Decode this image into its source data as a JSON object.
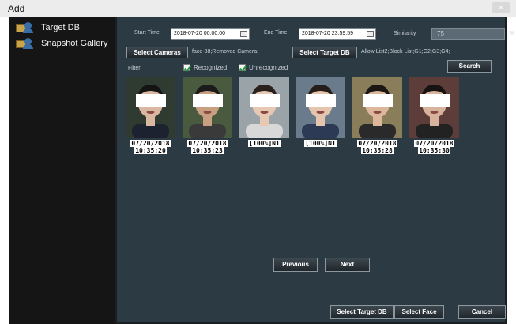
{
  "window": {
    "title": "Add",
    "close_label": "×"
  },
  "sidebar": {
    "items": [
      {
        "label": "Target DB",
        "icon": "database-user-icon"
      },
      {
        "label": "Snapshot Gallery",
        "icon": "gallery-user-icon"
      }
    ]
  },
  "filters": {
    "start_time_label": "Start Time",
    "start_time_value": "2018-07-20 00:00:00",
    "end_time_label": "End Time",
    "end_time_value": "2018-07-20 23:59:59",
    "similarity_label": "Similarity",
    "similarity_value": "75",
    "similarity_unit": "%",
    "select_cameras_label": "Select Cameras",
    "cameras_info": "face-38;Removed Camera;",
    "select_target_db_label": "Select Target DB",
    "target_db_info": "Allow List2;Block List;G1;G2;G3;G4;",
    "filter_label": "Filter",
    "recognized_label": "Recognized",
    "recognized_checked": true,
    "unrecognized_label": "Unrecognized",
    "unrecognized_checked": true,
    "search_label": "Search"
  },
  "snapshots": [
    {
      "line1": "07/20/2018",
      "line2": "10:35:20",
      "bg": "#2f3a30",
      "skin": "#d9b7a0",
      "hair": "#141414",
      "cloth": "#1c2230"
    },
    {
      "line1": "07/20/2018",
      "line2": "10:35:23",
      "bg": "#4a5a3e",
      "skin": "#c99f82",
      "hair": "#1b1b1b",
      "cloth": "#3a3a3a"
    },
    {
      "line1": "[100%]N1",
      "line2": "",
      "bg": "#9aa3a8",
      "skin": "#e7c8b3",
      "hair": "#2a211c",
      "cloth": "#d8d8d8"
    },
    {
      "line1": "[100%]N1",
      "line2": "",
      "bg": "#6a7c8c",
      "skin": "#e6c5ae",
      "hair": "#251d18",
      "cloth": "#2d3a55"
    },
    {
      "line1": "07/20/2018",
      "line2": "10:35:28",
      "bg": "#8a7d5a",
      "skin": "#dcb79c",
      "hair": "#1a1614",
      "cloth": "#2a2a2a"
    },
    {
      "line1": "07/20/2018",
      "line2": "10:35:30",
      "bg": "#5d3d3a",
      "skin": "#d7b39b",
      "hair": "#171312",
      "cloth": "#222222"
    }
  ],
  "pager": {
    "previous_label": "Previous",
    "next_label": "Next"
  },
  "footer": {
    "select_target_db_label": "Select Target DB",
    "select_face_label": "Select Face",
    "cancel_label": "Cancel"
  }
}
